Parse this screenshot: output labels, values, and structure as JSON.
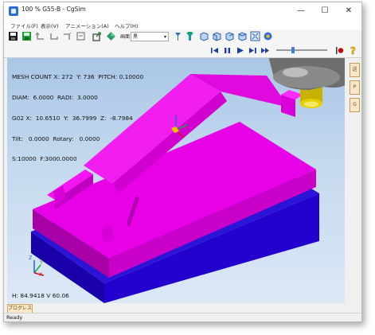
{
  "window": {
    "title": "100 % G55-B - CgSim",
    "minimize": "—",
    "maximize": "☐",
    "close": "✕"
  },
  "menu": [
    {
      "label": "ファイル(F)"
    },
    {
      "label": "表示(V)"
    },
    {
      "label": "アニメーション(A)"
    },
    {
      "label": "ヘルプ(H)"
    }
  ],
  "toolbar": {
    "view_select_caption": "画面",
    "view_select_value": "黒"
  },
  "info": {
    "line1": "MESH COUNT X: 272  Y: 736  PITCH: 0.10000",
    "line2": "DIAM:  6.0000  RADI:  3.0000",
    "line3": "G02 X:  10.6510  Y:  36.7999  Z:  -8.7984",
    "line4": "Tilt:   0.0000  Rotary:   0.0000",
    "line5": "S:10000  F:3000.0000"
  },
  "viewport": {
    "bottom_text": "H:  84.9418 V    60.06",
    "axis_labels": [
      "Z",
      "Y",
      "X"
    ]
  },
  "side_tabs": [
    "送",
    "P",
    "G"
  ],
  "progress_tab": "プログレス",
  "status": "Ready",
  "colors": {
    "part_top": "#e800e6",
    "part_side_light": "#d600d6",
    "part_side_dark": "#b800b8",
    "stock_front": "#2300ce",
    "stock_side": "#1a00a8",
    "tool_body": "#6e6e6e",
    "tool_tip": "#e6d000",
    "stop_red": "#cc0000",
    "help_yellow": "#f0c000"
  }
}
